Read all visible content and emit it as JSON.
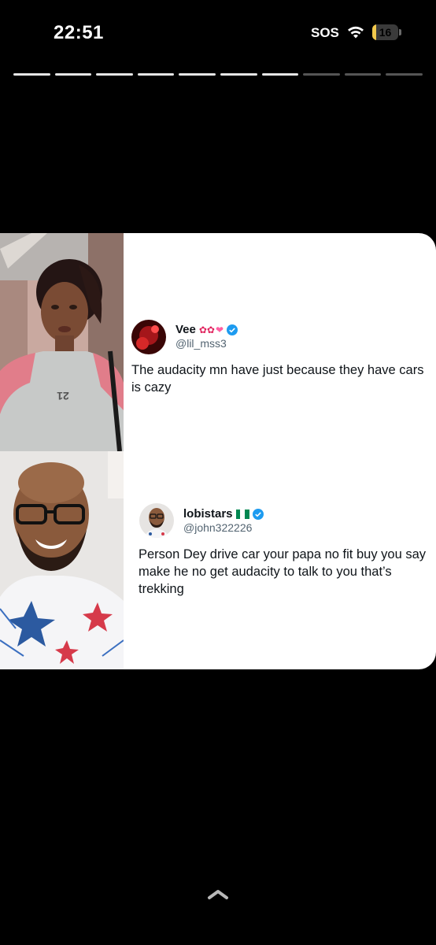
{
  "status_bar": {
    "time": "22:51",
    "carrier": "SOS",
    "battery_level": "16",
    "battery_fraction": 0.16,
    "battery_color": "#f2c94c"
  },
  "story": {
    "segments_total": 10,
    "segments_done": 7,
    "done_color": "#e6e6e6",
    "pending_color": "#555555"
  },
  "tweets": [
    {
      "display_name": "Vee",
      "handle": "@lil_mss3",
      "text": "The audacity m​n have just because they have cars is c​azy",
      "verified": true
    },
    {
      "display_name": "lobistars",
      "handle": "@john322226",
      "text": "Person Dey drive car your papa no fit buy you say make he no get audacity to talk to you that’s trekking",
      "verified": true
    }
  ],
  "icons": {
    "wifi": "wifi-icon",
    "verified": "verified-badge-icon",
    "swipe": "chevron-up-icon"
  },
  "colors": {
    "verified": "#1d9bf0",
    "card_bg": "#ffffff"
  }
}
